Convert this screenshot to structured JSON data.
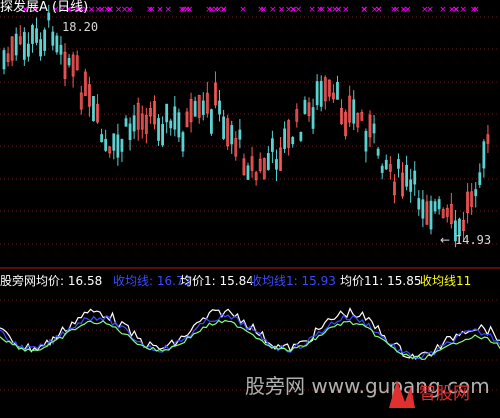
{
  "title": "探发展A (日线)",
  "chart_data": {
    "type": "candlestick",
    "upper_panel": {
      "high_marker": "18.20",
      "low_marker": "14.93",
      "low_arrow": "←",
      "up_color": "#ff5a5a",
      "down_color": "#5ad2d2",
      "x_marker_color": "#ff00ff",
      "bars_estimated": 120,
      "grid": "dotted red horizontal"
    },
    "lower_panel": {
      "legend": [
        {
          "label": "股旁网",
          "color": "#ffffff"
        },
        {
          "label": "均价: 16.58",
          "color": "#ffffff"
        },
        {
          "label": "收均线: 16.73",
          "color": "#3a4aff"
        },
        {
          "label": "均价1: 15.84",
          "color": "#ffffff"
        },
        {
          "label": "收均线1: 15.93",
          "color": "#3a4aff"
        },
        {
          "label": "均价11: 15.85",
          "color": "#ffffff"
        },
        {
          "label": "收均线11",
          "color": "#ffff00"
        }
      ],
      "series": [
        {
          "name": "均价",
          "color": "#ffffff"
        },
        {
          "name": "收均线",
          "color": "#3a4aff"
        },
        {
          "name": "均价11",
          "color": "#80ff80"
        }
      ]
    }
  },
  "watermark": "股旁网 www.gupang.com",
  "logo_text": "智股网"
}
